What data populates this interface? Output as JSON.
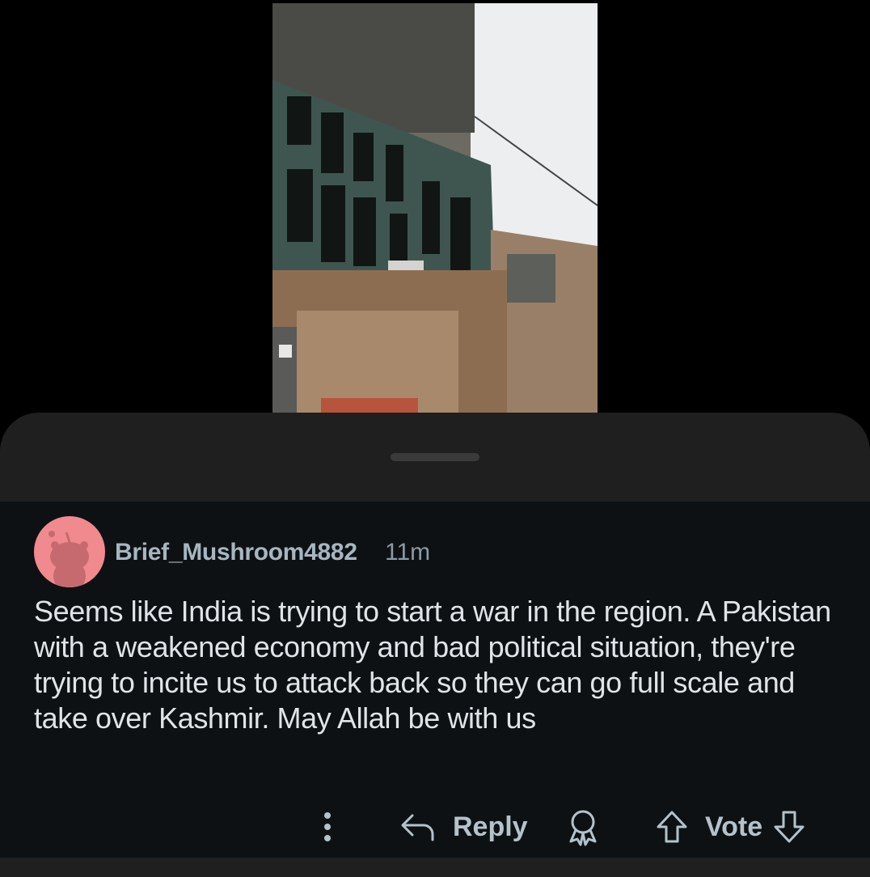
{
  "comment": {
    "author": "Brief_Mushroom4882",
    "time": "11m",
    "body": "Seems like India is trying to start a war in the region. A Pakistan with a weakened economy and bad political situation, they're trying to incite us to attack back so they can go full scale and take over Kashmir. May Allah be with us"
  },
  "actions": {
    "reply_label": "Reply",
    "vote_label": "Vote"
  },
  "icons": {
    "more": "more-vertical-icon",
    "reply": "reply-arrow-icon",
    "award": "award-icon",
    "upvote": "upvote-arrow-icon",
    "downvote": "downvote-arrow-icon"
  },
  "colors": {
    "avatar_bg": "#f08a8e",
    "sheet_bg": "#1f1f1f",
    "comment_bg": "#0e1113",
    "text": "#dfe4e8"
  }
}
